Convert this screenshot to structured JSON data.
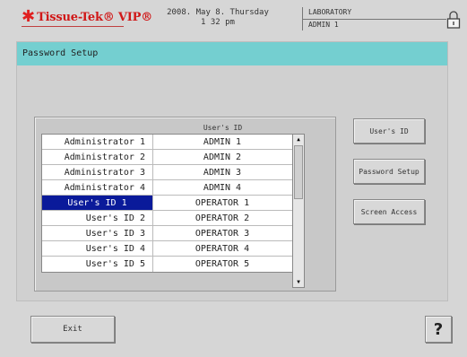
{
  "header": {
    "logo_text": "Tissue-Tek® VIP®",
    "date_line": "2008. May 8. Thursday",
    "time_line": "1 32 pm",
    "location": "LABORATORY",
    "user": "ADMIN 1"
  },
  "screen": {
    "title": "Password Setup"
  },
  "table": {
    "column_header": "User's ID",
    "rows": [
      {
        "label": "Administrator 1",
        "id": "ADMIN 1"
      },
      {
        "label": "Administrator 2",
        "id": "ADMIN 2"
      },
      {
        "label": "Administrator 3",
        "id": "ADMIN 3"
      },
      {
        "label": "Administrator 4",
        "id": "ADMIN 4"
      },
      {
        "label": "User's ID 1",
        "id": "OPERATOR 1"
      },
      {
        "label": "User's ID 2",
        "id": "OPERATOR 2"
      },
      {
        "label": "User's ID 3",
        "id": "OPERATOR 3"
      },
      {
        "label": "User's ID 4",
        "id": "OPERATOR 4"
      },
      {
        "label": "User's ID 5",
        "id": "OPERATOR 5"
      }
    ],
    "selected_row_label": "User's ID 1"
  },
  "side_buttons": {
    "users_id": "User's ID",
    "password_setup": "Password Setup",
    "screen_access": "Screen Access"
  },
  "footer": {
    "exit_label": "Exit",
    "help_label": "?"
  },
  "colors": {
    "title_bar": "#74cfd0",
    "selection": "#0a1a9a",
    "logo": "#d01818"
  },
  "icons": {
    "lock": "lock-icon",
    "logo_star": "star-logo-icon"
  }
}
